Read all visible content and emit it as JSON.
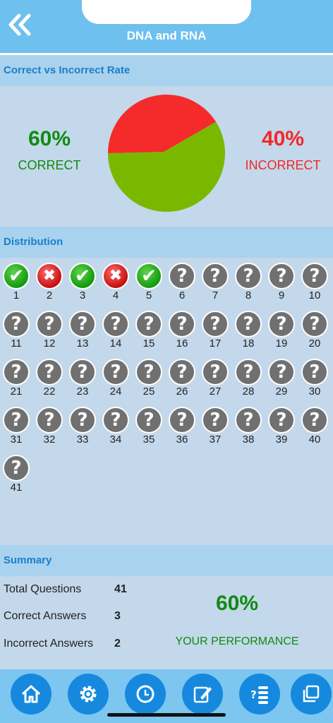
{
  "header": {
    "title": "DNA and RNA"
  },
  "rate_section": {
    "heading": "Correct vs Incorrect Rate",
    "correct_pct": "60%",
    "correct_label": "CORRECT",
    "incorrect_pct": "40%",
    "incorrect_label": "INCORRECT",
    "correct_fraction": 0.6,
    "colors": {
      "correct": "#7ab800",
      "incorrect": "#f52a2a"
    }
  },
  "distribution": {
    "heading": "Distribution",
    "items": [
      {
        "n": "1",
        "status": "correct"
      },
      {
        "n": "2",
        "status": "wrong"
      },
      {
        "n": "3",
        "status": "correct"
      },
      {
        "n": "4",
        "status": "wrong"
      },
      {
        "n": "5",
        "status": "correct"
      },
      {
        "n": "6",
        "status": "unknown"
      },
      {
        "n": "7",
        "status": "unknown"
      },
      {
        "n": "8",
        "status": "unknown"
      },
      {
        "n": "9",
        "status": "unknown"
      },
      {
        "n": "10",
        "status": "unknown"
      },
      {
        "n": "11",
        "status": "unknown"
      },
      {
        "n": "12",
        "status": "unknown"
      },
      {
        "n": "13",
        "status": "unknown"
      },
      {
        "n": "14",
        "status": "unknown"
      },
      {
        "n": "15",
        "status": "unknown"
      },
      {
        "n": "16",
        "status": "unknown"
      },
      {
        "n": "17",
        "status": "unknown"
      },
      {
        "n": "18",
        "status": "unknown"
      },
      {
        "n": "19",
        "status": "unknown"
      },
      {
        "n": "20",
        "status": "unknown"
      },
      {
        "n": "21",
        "status": "unknown"
      },
      {
        "n": "22",
        "status": "unknown"
      },
      {
        "n": "23",
        "status": "unknown"
      },
      {
        "n": "24",
        "status": "unknown"
      },
      {
        "n": "25",
        "status": "unknown"
      },
      {
        "n": "26",
        "status": "unknown"
      },
      {
        "n": "27",
        "status": "unknown"
      },
      {
        "n": "28",
        "status": "unknown"
      },
      {
        "n": "29",
        "status": "unknown"
      },
      {
        "n": "30",
        "status": "unknown"
      },
      {
        "n": "31",
        "status": "unknown"
      },
      {
        "n": "32",
        "status": "unknown"
      },
      {
        "n": "33",
        "status": "unknown"
      },
      {
        "n": "34",
        "status": "unknown"
      },
      {
        "n": "35",
        "status": "unknown"
      },
      {
        "n": "36",
        "status": "unknown"
      },
      {
        "n": "37",
        "status": "unknown"
      },
      {
        "n": "38",
        "status": "unknown"
      },
      {
        "n": "39",
        "status": "unknown"
      },
      {
        "n": "40",
        "status": "unknown"
      },
      {
        "n": "41",
        "status": "unknown"
      }
    ]
  },
  "summary": {
    "heading": "Summary",
    "total_label": "Total Questions",
    "total_value": "41",
    "correct_label": "Correct Answers",
    "correct_value": "3",
    "incorrect_label": "Incorrect Answers",
    "incorrect_value": "2",
    "performance_pct": "60%",
    "performance_label": "YOUR PERFORMANCE"
  },
  "tabbar": {
    "tabs": [
      {
        "icon": "home-icon"
      },
      {
        "icon": "gear-icon"
      },
      {
        "icon": "clock-icon"
      },
      {
        "icon": "edit-icon"
      },
      {
        "icon": "quiz-list-icon"
      },
      {
        "icon": "copy-icon"
      }
    ]
  }
}
